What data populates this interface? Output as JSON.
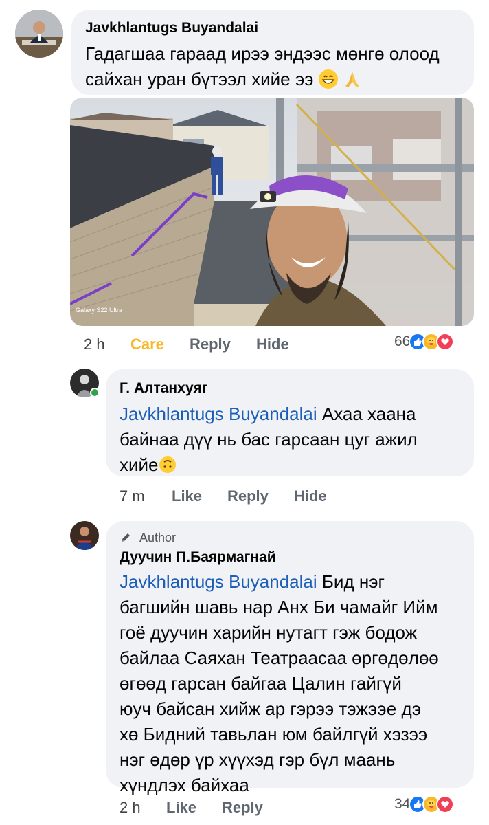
{
  "comments": [
    {
      "author": "Javkhlantugs Buyandalai",
      "text": "Гадагшаа гараад ирээ эндээс мөнгө олоод сайхан уран бүтээл хийе ээ",
      "photo_watermark": "Galaxy S22 Ultra",
      "time": "2 h",
      "actions": [
        "Care",
        "Reply",
        "Hide"
      ],
      "reaction_count": "66"
    },
    {
      "author": "Г. Алтанхуяг",
      "mention": "Javkhlantugs Buyandalai",
      "text_line1": " Ахаа хаана",
      "text_line2": "байнаа дүү нь бас гарсаан цуг ажил",
      "text_line3": "хийе",
      "time": "7 m",
      "actions": [
        "Like",
        "Reply",
        "Hide"
      ]
    },
    {
      "badge": "Author",
      "author": "Дуучин П.Баярмагнай",
      "mention": "Javkhlantugs Buyandalai",
      "lines": [
        " Бид нэг",
        "багшийн шавь нар Анх Би чамайг Ийм",
        "гоё дуучин харийн нутагт гэж бодож",
        "байлаа Саяхан Театраасаа өргөдөлөө",
        "өгөөд гарсан байгаа Цалин гайгүй",
        "юуч байсан хийж ар гэрээ тэжээе дэ",
        "хө Бидний тавьлан юм байлгүй хэзээ",
        "нэг өдөр үр хүүхэд гэр бүл маань",
        "хүндлэх байхаа"
      ],
      "time": "2 h",
      "actions": [
        "Like",
        "Reply"
      ],
      "reaction_count": "34"
    }
  ],
  "colors": {
    "bubble": "#f0f2f5",
    "mention": "#1d5fb8",
    "care": "#f7b928",
    "like": "#1877f2",
    "love": "#f33e58"
  }
}
